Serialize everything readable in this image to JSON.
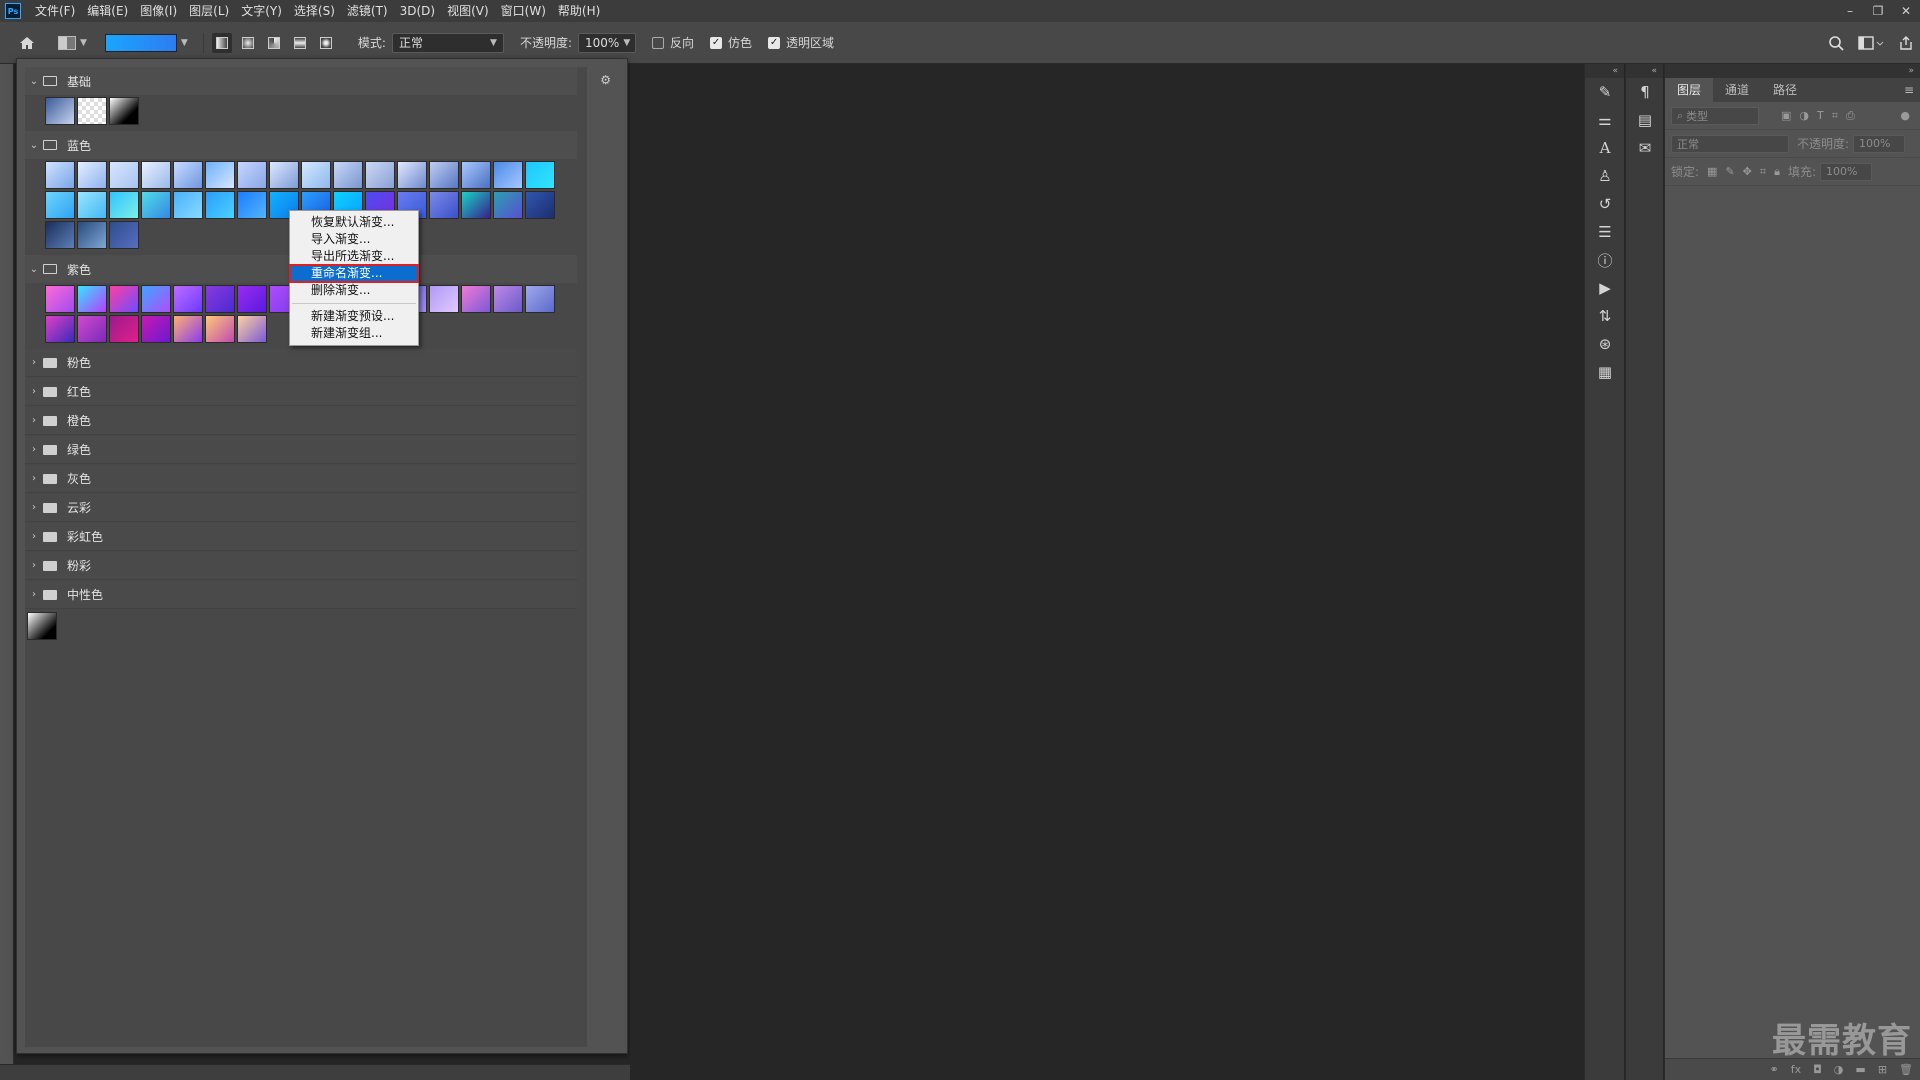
{
  "app": {
    "logo": "Ps"
  },
  "menu": [
    "文件(F)",
    "编辑(E)",
    "图像(I)",
    "图层(L)",
    "文字(Y)",
    "选择(S)",
    "滤镜(T)",
    "3D(D)",
    "视图(V)",
    "窗口(W)",
    "帮助(H)"
  ],
  "window_controls": {
    "minimize": "–",
    "restore": "❐",
    "close": "✕"
  },
  "options": {
    "mode_label": "模式:",
    "mode_value": "正常",
    "opacity_label": "不透明度:",
    "opacity_value": "100%",
    "reverse_label": "反向",
    "reverse_checked": false,
    "dither_label": "仿色",
    "dither_checked": true,
    "transparency_label": "透明区域",
    "transparency_checked": true
  },
  "gradient_panel": {
    "groups": [
      {
        "name": "基础",
        "expanded": true
      },
      {
        "name": "蓝色",
        "expanded": true
      },
      {
        "name": "紫色",
        "expanded": true
      },
      {
        "name": "粉色",
        "expanded": false
      },
      {
        "name": "红色",
        "expanded": false
      },
      {
        "name": "橙色",
        "expanded": false
      },
      {
        "name": "绿色",
        "expanded": false
      },
      {
        "name": "灰色",
        "expanded": false
      },
      {
        "name": "云彩",
        "expanded": false
      },
      {
        "name": "彩虹色",
        "expanded": false
      },
      {
        "name": "粉彩",
        "expanded": false
      },
      {
        "name": "中性色",
        "expanded": false
      }
    ],
    "basic_swatches": [
      "linear-gradient(135deg,#3a5a9a,#c8d4ee)",
      "repeating-conic-gradient(#ddd 0 25%, #fff 0 50%) 0 0/8px 8px",
      "linear-gradient(135deg,#fff,#000 70%)"
    ],
    "blue_swatches": [
      "linear-gradient(135deg,#cfe3ff,#7aa4e6)",
      "linear-gradient(135deg,#e4eeff,#8fb2ef)",
      "linear-gradient(135deg,#d8e6ff,#a8c2f0)",
      "linear-gradient(135deg,#e9f1ff,#9ab8ea)",
      "linear-gradient(135deg,#c8dbff,#6f97df)",
      "linear-gradient(135deg,#6db0ff,#d8e8ff)",
      "linear-gradient(135deg,#c6d6ff,#8aa6e6)",
      "linear-gradient(135deg,#dde8ff,#7e9bd6)",
      "linear-gradient(135deg,#d3e7ff,#90b8ee)",
      "linear-gradient(135deg,#c7d7f7,#7a96cf)",
      "linear-gradient(135deg,#cbd8f5,#8ba0d4)",
      "linear-gradient(135deg,#e2e8ff,#6e88cc)",
      "linear-gradient(135deg,#c0cdf0,#5777c3)",
      "linear-gradient(135deg,#a9c8ff,#4b6fc0)",
      "linear-gradient(135deg,#4c8ae8,#a6c8ff)",
      "linear-gradient(135deg,#1fc6ff,#31e4ff)",
      "linear-gradient(135deg,#6ed4ff,#2ea3ef)",
      "linear-gradient(135deg,#9ae6ff,#44b6f4)",
      "linear-gradient(135deg,#2ec4ff,#7ef0e6)",
      "linear-gradient(135deg,#4fdce8,#3787e2)",
      "linear-gradient(135deg,#48b2ff,#89d8ff)",
      "linear-gradient(135deg,#2a9cff,#4ad2ff)",
      "linear-gradient(135deg,#1a7cff,#54b5ff)",
      "linear-gradient(135deg,#12b2ff,#0c7ce8)",
      "linear-gradient(135deg,#2aa0ff,#1d5ce0)",
      "linear-gradient(135deg,#0dd2ff,#0aa0ff)",
      "linear-gradient(135deg,#4a4df0,#7b2ee0)",
      "linear-gradient(135deg,#6a7cf0,#3a5ad8)",
      "linear-gradient(135deg,#7a8ae8,#3c50c8)",
      "linear-gradient(135deg,#1ad2c8,#3a1f8c)",
      "linear-gradient(135deg,#2a9fb0,#5a4fd0)",
      "linear-gradient(135deg,#3056b0,#1c2e6e)",
      "linear-gradient(135deg,#1c2e5c,#5d7fb8)",
      "linear-gradient(135deg,#294a7a,#7fa8d6)",
      "linear-gradient(135deg,#2c4e8c,#5a6ec0)"
    ],
    "purple_swatches": [
      "linear-gradient(135deg,#ff6ad5,#a04cf0)",
      "linear-gradient(135deg,#36e4ff,#b63cff)",
      "linear-gradient(135deg,#ff3fa4,#6c4cff)",
      "linear-gradient(135deg,#3ea5ff,#b24dff)",
      "linear-gradient(135deg,#c06bff,#6a3bff)",
      "linear-gradient(135deg,#8a3ae0,#4a2ad0)",
      "linear-gradient(135deg,#9a2cf0,#5a1ae0)",
      "linear-gradient(135deg,#b04cff,#7c3ae8)",
      "linear-gradient(135deg,#8c4cf0,#5a2ad8)",
      "linear-gradient(135deg,#a86cf4,#6a4ad8)",
      "linear-gradient(135deg,#8a6ae0,#c0a0f8)",
      "linear-gradient(135deg,#6a5cd8,#a48ff0)",
      "linear-gradient(135deg,#b09af8,#e0c8ff)",
      "linear-gradient(135deg,#f07ad4,#7a5ad8)",
      "linear-gradient(135deg,#c088e8,#6a5ac8)",
      "linear-gradient(135deg,#a0a8ee,#5a6ac8)",
      "linear-gradient(135deg,#e040c8,#3a2ab8)",
      "linear-gradient(135deg,#d04ad0,#7a2ab8)",
      "linear-gradient(135deg,#9a1a8c,#e0208c)",
      "linear-gradient(135deg,#c81ab0,#6a1ad0)",
      "linear-gradient(135deg,#ffb070,#8a3af0)",
      "linear-gradient(135deg,#ffc87a,#c04ab0)",
      "linear-gradient(135deg,#ffd0a0,#7a5ad8)"
    ],
    "neutral_swatch": "linear-gradient(135deg,#fff,#000 75%)"
  },
  "context_menu": [
    {
      "label": "恢复默认渐变...",
      "selected": false
    },
    {
      "label": "导入渐变...",
      "selected": false
    },
    {
      "label": "导出所选渐变...",
      "selected": false
    },
    {
      "label": "重命名渐变...",
      "selected": true
    },
    {
      "label": "删除渐变...",
      "selected": false
    },
    {
      "separator": true
    },
    {
      "label": "新建渐变预设...",
      "selected": false
    },
    {
      "label": "新建渐变组...",
      "selected": false
    }
  ],
  "layers_panel": {
    "tabs": [
      "图层",
      "通道",
      "路径"
    ],
    "active_tab": "图层",
    "filter_placeholder": "类型",
    "blend_mode": "正常",
    "opacity_label": "不透明度:",
    "opacity_value": "100%",
    "lock_label": "锁定:",
    "fill_label": "填充:",
    "fill_value": "100%"
  },
  "watermark": "最需教育"
}
